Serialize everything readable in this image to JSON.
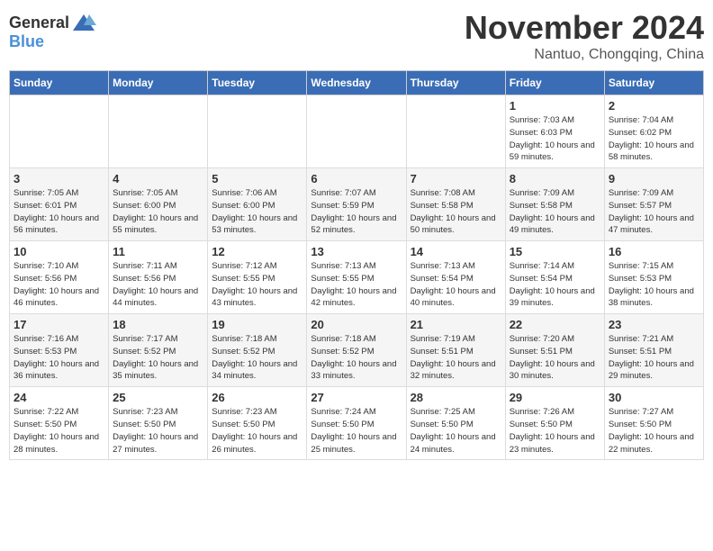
{
  "header": {
    "logo_general": "General",
    "logo_blue": "Blue",
    "month": "November 2024",
    "location": "Nantuo, Chongqing, China"
  },
  "weekdays": [
    "Sunday",
    "Monday",
    "Tuesday",
    "Wednesday",
    "Thursday",
    "Friday",
    "Saturday"
  ],
  "weeks": [
    [
      {
        "day": "",
        "info": ""
      },
      {
        "day": "",
        "info": ""
      },
      {
        "day": "",
        "info": ""
      },
      {
        "day": "",
        "info": ""
      },
      {
        "day": "",
        "info": ""
      },
      {
        "day": "1",
        "info": "Sunrise: 7:03 AM\nSunset: 6:03 PM\nDaylight: 10 hours and 59 minutes."
      },
      {
        "day": "2",
        "info": "Sunrise: 7:04 AM\nSunset: 6:02 PM\nDaylight: 10 hours and 58 minutes."
      }
    ],
    [
      {
        "day": "3",
        "info": "Sunrise: 7:05 AM\nSunset: 6:01 PM\nDaylight: 10 hours and 56 minutes."
      },
      {
        "day": "4",
        "info": "Sunrise: 7:05 AM\nSunset: 6:00 PM\nDaylight: 10 hours and 55 minutes."
      },
      {
        "day": "5",
        "info": "Sunrise: 7:06 AM\nSunset: 6:00 PM\nDaylight: 10 hours and 53 minutes."
      },
      {
        "day": "6",
        "info": "Sunrise: 7:07 AM\nSunset: 5:59 PM\nDaylight: 10 hours and 52 minutes."
      },
      {
        "day": "7",
        "info": "Sunrise: 7:08 AM\nSunset: 5:58 PM\nDaylight: 10 hours and 50 minutes."
      },
      {
        "day": "8",
        "info": "Sunrise: 7:09 AM\nSunset: 5:58 PM\nDaylight: 10 hours and 49 minutes."
      },
      {
        "day": "9",
        "info": "Sunrise: 7:09 AM\nSunset: 5:57 PM\nDaylight: 10 hours and 47 minutes."
      }
    ],
    [
      {
        "day": "10",
        "info": "Sunrise: 7:10 AM\nSunset: 5:56 PM\nDaylight: 10 hours and 46 minutes."
      },
      {
        "day": "11",
        "info": "Sunrise: 7:11 AM\nSunset: 5:56 PM\nDaylight: 10 hours and 44 minutes."
      },
      {
        "day": "12",
        "info": "Sunrise: 7:12 AM\nSunset: 5:55 PM\nDaylight: 10 hours and 43 minutes."
      },
      {
        "day": "13",
        "info": "Sunrise: 7:13 AM\nSunset: 5:55 PM\nDaylight: 10 hours and 42 minutes."
      },
      {
        "day": "14",
        "info": "Sunrise: 7:13 AM\nSunset: 5:54 PM\nDaylight: 10 hours and 40 minutes."
      },
      {
        "day": "15",
        "info": "Sunrise: 7:14 AM\nSunset: 5:54 PM\nDaylight: 10 hours and 39 minutes."
      },
      {
        "day": "16",
        "info": "Sunrise: 7:15 AM\nSunset: 5:53 PM\nDaylight: 10 hours and 38 minutes."
      }
    ],
    [
      {
        "day": "17",
        "info": "Sunrise: 7:16 AM\nSunset: 5:53 PM\nDaylight: 10 hours and 36 minutes."
      },
      {
        "day": "18",
        "info": "Sunrise: 7:17 AM\nSunset: 5:52 PM\nDaylight: 10 hours and 35 minutes."
      },
      {
        "day": "19",
        "info": "Sunrise: 7:18 AM\nSunset: 5:52 PM\nDaylight: 10 hours and 34 minutes."
      },
      {
        "day": "20",
        "info": "Sunrise: 7:18 AM\nSunset: 5:52 PM\nDaylight: 10 hours and 33 minutes."
      },
      {
        "day": "21",
        "info": "Sunrise: 7:19 AM\nSunset: 5:51 PM\nDaylight: 10 hours and 32 minutes."
      },
      {
        "day": "22",
        "info": "Sunrise: 7:20 AM\nSunset: 5:51 PM\nDaylight: 10 hours and 30 minutes."
      },
      {
        "day": "23",
        "info": "Sunrise: 7:21 AM\nSunset: 5:51 PM\nDaylight: 10 hours and 29 minutes."
      }
    ],
    [
      {
        "day": "24",
        "info": "Sunrise: 7:22 AM\nSunset: 5:50 PM\nDaylight: 10 hours and 28 minutes."
      },
      {
        "day": "25",
        "info": "Sunrise: 7:23 AM\nSunset: 5:50 PM\nDaylight: 10 hours and 27 minutes."
      },
      {
        "day": "26",
        "info": "Sunrise: 7:23 AM\nSunset: 5:50 PM\nDaylight: 10 hours and 26 minutes."
      },
      {
        "day": "27",
        "info": "Sunrise: 7:24 AM\nSunset: 5:50 PM\nDaylight: 10 hours and 25 minutes."
      },
      {
        "day": "28",
        "info": "Sunrise: 7:25 AM\nSunset: 5:50 PM\nDaylight: 10 hours and 24 minutes."
      },
      {
        "day": "29",
        "info": "Sunrise: 7:26 AM\nSunset: 5:50 PM\nDaylight: 10 hours and 23 minutes."
      },
      {
        "day": "30",
        "info": "Sunrise: 7:27 AM\nSunset: 5:50 PM\nDaylight: 10 hours and 22 minutes."
      }
    ]
  ]
}
